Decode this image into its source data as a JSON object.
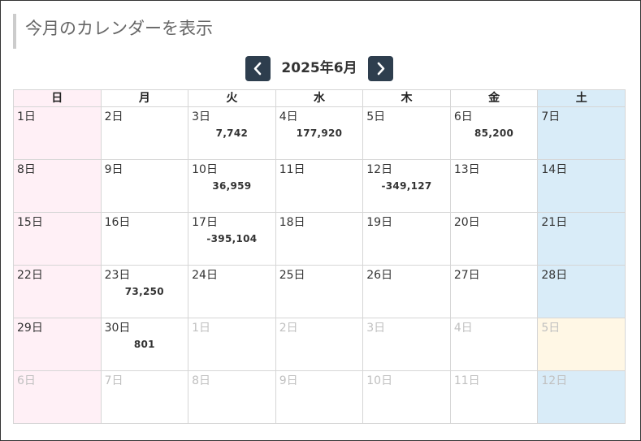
{
  "heading": "今月のカレンダーを表示",
  "nav": {
    "month_label": "2025年6月"
  },
  "weekdays": [
    "日",
    "月",
    "火",
    "水",
    "木",
    "金",
    "土"
  ],
  "weeks": [
    [
      {
        "day": "1日",
        "amount": ""
      },
      {
        "day": "2日",
        "amount": ""
      },
      {
        "day": "3日",
        "amount": "7,742"
      },
      {
        "day": "4日",
        "amount": "177,920"
      },
      {
        "day": "5日",
        "amount": ""
      },
      {
        "day": "6日",
        "amount": "85,200"
      },
      {
        "day": "7日",
        "amount": ""
      }
    ],
    [
      {
        "day": "8日",
        "amount": ""
      },
      {
        "day": "9日",
        "amount": ""
      },
      {
        "day": "10日",
        "amount": "36,959"
      },
      {
        "day": "11日",
        "amount": ""
      },
      {
        "day": "12日",
        "amount": "-349,127"
      },
      {
        "day": "13日",
        "amount": ""
      },
      {
        "day": "14日",
        "amount": ""
      }
    ],
    [
      {
        "day": "15日",
        "amount": ""
      },
      {
        "day": "16日",
        "amount": ""
      },
      {
        "day": "17日",
        "amount": "-395,104"
      },
      {
        "day": "18日",
        "amount": ""
      },
      {
        "day": "19日",
        "amount": ""
      },
      {
        "day": "20日",
        "amount": ""
      },
      {
        "day": "21日",
        "amount": ""
      }
    ],
    [
      {
        "day": "22日",
        "amount": ""
      },
      {
        "day": "23日",
        "amount": "73,250"
      },
      {
        "day": "24日",
        "amount": ""
      },
      {
        "day": "25日",
        "amount": ""
      },
      {
        "day": "26日",
        "amount": ""
      },
      {
        "day": "27日",
        "amount": ""
      },
      {
        "day": "28日",
        "amount": ""
      }
    ],
    [
      {
        "day": "29日",
        "amount": ""
      },
      {
        "day": "30日",
        "amount": "801"
      },
      {
        "day": "1日",
        "amount": "",
        "other": true
      },
      {
        "day": "2日",
        "amount": "",
        "other": true
      },
      {
        "day": "3日",
        "amount": "",
        "other": true
      },
      {
        "day": "4日",
        "amount": "",
        "other": true
      },
      {
        "day": "5日",
        "amount": "",
        "other": true,
        "today": true
      }
    ],
    [
      {
        "day": "6日",
        "amount": "",
        "other": true
      },
      {
        "day": "7日",
        "amount": "",
        "other": true
      },
      {
        "day": "8日",
        "amount": "",
        "other": true
      },
      {
        "day": "9日",
        "amount": "",
        "other": true
      },
      {
        "day": "10日",
        "amount": "",
        "other": true
      },
      {
        "day": "11日",
        "amount": "",
        "other": true
      },
      {
        "day": "12日",
        "amount": "",
        "other": true
      }
    ]
  ],
  "colors": {
    "sunday_bg": "#fff0f6",
    "saturday_bg": "#d9ecf8",
    "today_bg": "#fff7e5",
    "nav_button_bg": "#2e3e4e"
  },
  "icons": {
    "prev": "chevron-left-icon",
    "next": "chevron-right-icon"
  }
}
